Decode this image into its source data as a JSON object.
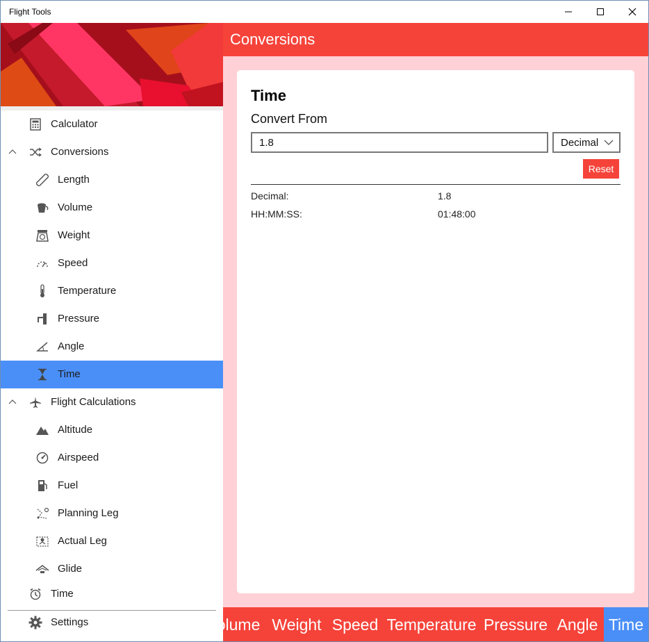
{
  "window": {
    "title": "Flight Tools"
  },
  "sidebar": {
    "items": [
      {
        "label": "Calculator"
      },
      {
        "label": "Conversions"
      },
      {
        "label": "Length"
      },
      {
        "label": "Volume"
      },
      {
        "label": "Weight"
      },
      {
        "label": "Speed"
      },
      {
        "label": "Temperature"
      },
      {
        "label": "Pressure"
      },
      {
        "label": "Angle"
      },
      {
        "label": "Time"
      },
      {
        "label": "Flight Calculations"
      },
      {
        "label": "Altitude"
      },
      {
        "label": "Airspeed"
      },
      {
        "label": "Fuel"
      },
      {
        "label": "Planning Leg"
      },
      {
        "label": "Actual Leg"
      },
      {
        "label": "Glide"
      },
      {
        "label": "Time"
      },
      {
        "label": "Settings"
      }
    ],
    "icons": [
      "calculator-icon",
      "shuffle-icon",
      "ruler-icon",
      "bucket-icon",
      "scale-icon",
      "speedometer-icon",
      "thermometer-icon",
      "pressure-icon",
      "angle-icon",
      "hourglass-icon",
      "airplane-icon",
      "mountain-icon",
      "gauge-icon",
      "fuel-pump-icon",
      "route-icon",
      "location-route-icon",
      "glider-icon",
      "alarm-clock-icon",
      "gear-icon"
    ]
  },
  "header": {
    "title": "Conversions"
  },
  "card": {
    "title": "Time",
    "convert_from_label": "Convert From",
    "input_value": "1.8",
    "unit_selected": "Decimal",
    "reset_label": "Reset",
    "results": [
      {
        "label": "Decimal:",
        "value": "1.8"
      },
      {
        "label": "HH:MM:SS:",
        "value": "01:48:00"
      }
    ]
  },
  "tabs": [
    {
      "label": "Volume"
    },
    {
      "label": "Weight"
    },
    {
      "label": "Speed"
    },
    {
      "label": "Temperature"
    },
    {
      "label": "Pressure"
    },
    {
      "label": "Angle"
    },
    {
      "label": "Time"
    }
  ],
  "colors": {
    "accent": "#f5433a",
    "selection": "#4a8ff8",
    "content_bg": "#ffd1d6"
  }
}
